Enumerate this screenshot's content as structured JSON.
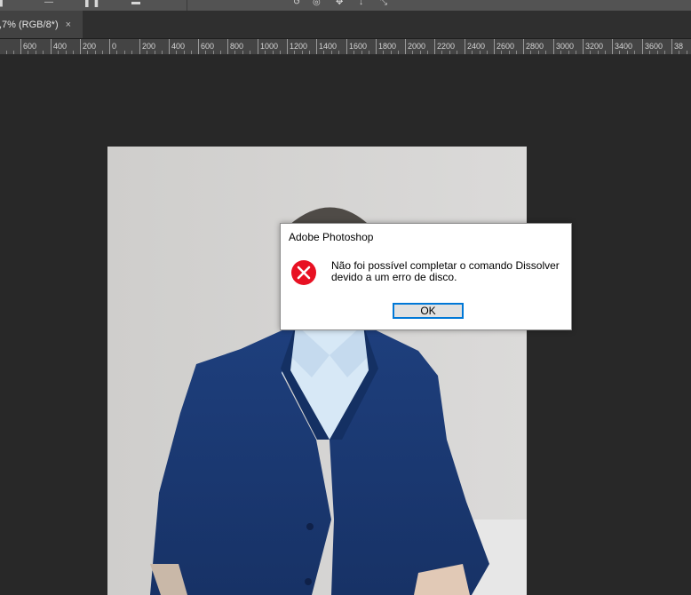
{
  "document_tab": {
    "title": ",7% (RGB/8*)",
    "close_glyph": "×"
  },
  "ruler": {
    "unit_labels": [
      "0",
      "600",
      "400",
      "200",
      "0",
      "200",
      "400",
      "600",
      "800",
      "1000",
      "1200",
      "1400",
      "1600",
      "1800",
      "2000",
      "2200",
      "2400",
      "2600",
      "2800",
      "3000",
      "3200",
      "3400",
      "3600",
      "38"
    ]
  },
  "dialog": {
    "title": "Adobe Photoshop",
    "message_line1": "Não foi possível completar o comando Dissolver",
    "message_line2": "devido a um erro de disco.",
    "ok_label": "OK",
    "icon": "error-icon"
  },
  "colors": {
    "workspace": "#282828",
    "error_red": "#e81123",
    "focus_blue": "#0078d7",
    "suit_blue": "#1c3a74"
  }
}
